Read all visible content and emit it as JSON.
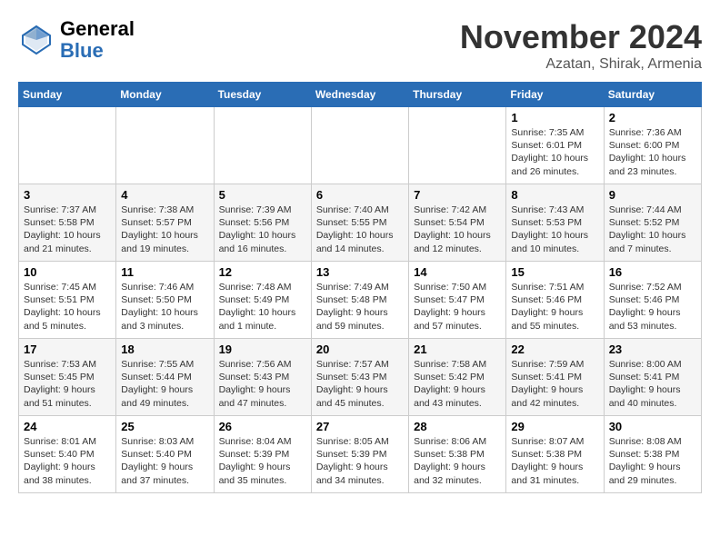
{
  "header": {
    "logo_line1": "General",
    "logo_line2": "Blue",
    "month_title": "November 2024",
    "location": "Azatan, Shirak, Armenia"
  },
  "days_of_week": [
    "Sunday",
    "Monday",
    "Tuesday",
    "Wednesday",
    "Thursday",
    "Friday",
    "Saturday"
  ],
  "weeks": [
    [
      {
        "day": "",
        "info": ""
      },
      {
        "day": "",
        "info": ""
      },
      {
        "day": "",
        "info": ""
      },
      {
        "day": "",
        "info": ""
      },
      {
        "day": "",
        "info": ""
      },
      {
        "day": "1",
        "info": "Sunrise: 7:35 AM\nSunset: 6:01 PM\nDaylight: 10 hours and 26 minutes."
      },
      {
        "day": "2",
        "info": "Sunrise: 7:36 AM\nSunset: 6:00 PM\nDaylight: 10 hours and 23 minutes."
      }
    ],
    [
      {
        "day": "3",
        "info": "Sunrise: 7:37 AM\nSunset: 5:58 PM\nDaylight: 10 hours and 21 minutes."
      },
      {
        "day": "4",
        "info": "Sunrise: 7:38 AM\nSunset: 5:57 PM\nDaylight: 10 hours and 19 minutes."
      },
      {
        "day": "5",
        "info": "Sunrise: 7:39 AM\nSunset: 5:56 PM\nDaylight: 10 hours and 16 minutes."
      },
      {
        "day": "6",
        "info": "Sunrise: 7:40 AM\nSunset: 5:55 PM\nDaylight: 10 hours and 14 minutes."
      },
      {
        "day": "7",
        "info": "Sunrise: 7:42 AM\nSunset: 5:54 PM\nDaylight: 10 hours and 12 minutes."
      },
      {
        "day": "8",
        "info": "Sunrise: 7:43 AM\nSunset: 5:53 PM\nDaylight: 10 hours and 10 minutes."
      },
      {
        "day": "9",
        "info": "Sunrise: 7:44 AM\nSunset: 5:52 PM\nDaylight: 10 hours and 7 minutes."
      }
    ],
    [
      {
        "day": "10",
        "info": "Sunrise: 7:45 AM\nSunset: 5:51 PM\nDaylight: 10 hours and 5 minutes."
      },
      {
        "day": "11",
        "info": "Sunrise: 7:46 AM\nSunset: 5:50 PM\nDaylight: 10 hours and 3 minutes."
      },
      {
        "day": "12",
        "info": "Sunrise: 7:48 AM\nSunset: 5:49 PM\nDaylight: 10 hours and 1 minute."
      },
      {
        "day": "13",
        "info": "Sunrise: 7:49 AM\nSunset: 5:48 PM\nDaylight: 9 hours and 59 minutes."
      },
      {
        "day": "14",
        "info": "Sunrise: 7:50 AM\nSunset: 5:47 PM\nDaylight: 9 hours and 57 minutes."
      },
      {
        "day": "15",
        "info": "Sunrise: 7:51 AM\nSunset: 5:46 PM\nDaylight: 9 hours and 55 minutes."
      },
      {
        "day": "16",
        "info": "Sunrise: 7:52 AM\nSunset: 5:46 PM\nDaylight: 9 hours and 53 minutes."
      }
    ],
    [
      {
        "day": "17",
        "info": "Sunrise: 7:53 AM\nSunset: 5:45 PM\nDaylight: 9 hours and 51 minutes."
      },
      {
        "day": "18",
        "info": "Sunrise: 7:55 AM\nSunset: 5:44 PM\nDaylight: 9 hours and 49 minutes."
      },
      {
        "day": "19",
        "info": "Sunrise: 7:56 AM\nSunset: 5:43 PM\nDaylight: 9 hours and 47 minutes."
      },
      {
        "day": "20",
        "info": "Sunrise: 7:57 AM\nSunset: 5:43 PM\nDaylight: 9 hours and 45 minutes."
      },
      {
        "day": "21",
        "info": "Sunrise: 7:58 AM\nSunset: 5:42 PM\nDaylight: 9 hours and 43 minutes."
      },
      {
        "day": "22",
        "info": "Sunrise: 7:59 AM\nSunset: 5:41 PM\nDaylight: 9 hours and 42 minutes."
      },
      {
        "day": "23",
        "info": "Sunrise: 8:00 AM\nSunset: 5:41 PM\nDaylight: 9 hours and 40 minutes."
      }
    ],
    [
      {
        "day": "24",
        "info": "Sunrise: 8:01 AM\nSunset: 5:40 PM\nDaylight: 9 hours and 38 minutes."
      },
      {
        "day": "25",
        "info": "Sunrise: 8:03 AM\nSunset: 5:40 PM\nDaylight: 9 hours and 37 minutes."
      },
      {
        "day": "26",
        "info": "Sunrise: 8:04 AM\nSunset: 5:39 PM\nDaylight: 9 hours and 35 minutes."
      },
      {
        "day": "27",
        "info": "Sunrise: 8:05 AM\nSunset: 5:39 PM\nDaylight: 9 hours and 34 minutes."
      },
      {
        "day": "28",
        "info": "Sunrise: 8:06 AM\nSunset: 5:38 PM\nDaylight: 9 hours and 32 minutes."
      },
      {
        "day": "29",
        "info": "Sunrise: 8:07 AM\nSunset: 5:38 PM\nDaylight: 9 hours and 31 minutes."
      },
      {
        "day": "30",
        "info": "Sunrise: 8:08 AM\nSunset: 5:38 PM\nDaylight: 9 hours and 29 minutes."
      }
    ]
  ]
}
